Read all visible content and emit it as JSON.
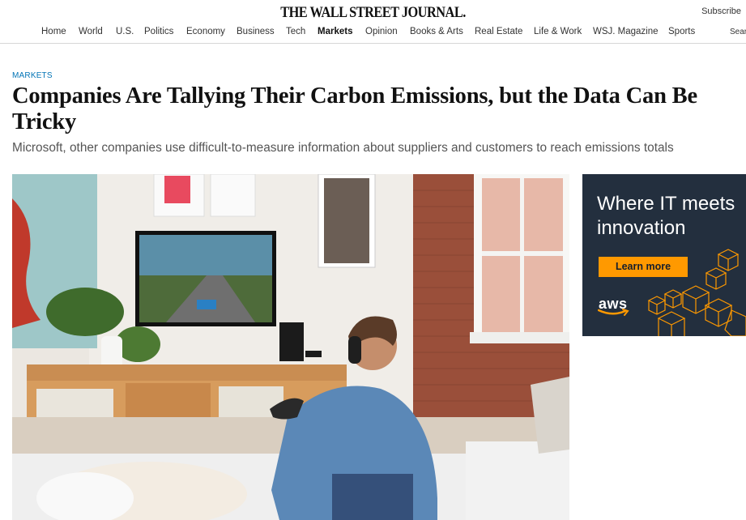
{
  "header": {
    "logo": "THE WALL STREET JOURNAL.",
    "subscribe": "Subscribe",
    "nav": [
      {
        "label": "Home",
        "active": false
      },
      {
        "label": "World",
        "active": false
      },
      {
        "label": "U.S.",
        "active": false
      },
      {
        "label": "Politics",
        "active": false
      },
      {
        "label": "Economy",
        "active": false
      },
      {
        "label": "Business",
        "active": false
      },
      {
        "label": "Tech",
        "active": false
      },
      {
        "label": "Markets",
        "active": true
      },
      {
        "label": "Opinion",
        "active": false
      },
      {
        "label": "Books & Arts",
        "active": false
      },
      {
        "label": "Real Estate",
        "active": false
      },
      {
        "label": "Life & Work",
        "active": false
      },
      {
        "label": "WSJ. Magazine",
        "active": false
      },
      {
        "label": "Sports",
        "active": false
      }
    ],
    "search": "Search"
  },
  "article": {
    "section": "MARKETS",
    "headline": "Companies Are Tallying Their Carbon Emissions, but the Data Can Be Tricky",
    "dek": "Microsoft, other companies use difficult-to-measure information about suppliers and customers to reach emissions totals",
    "hero_icon": "photo-man-playing-video-game-icon"
  },
  "ad": {
    "headline": "Where IT meets\ninnovation",
    "cta": "Learn more",
    "brand": "aws",
    "colors": {
      "background": "#232f3e",
      "accent": "#ff9900"
    }
  }
}
